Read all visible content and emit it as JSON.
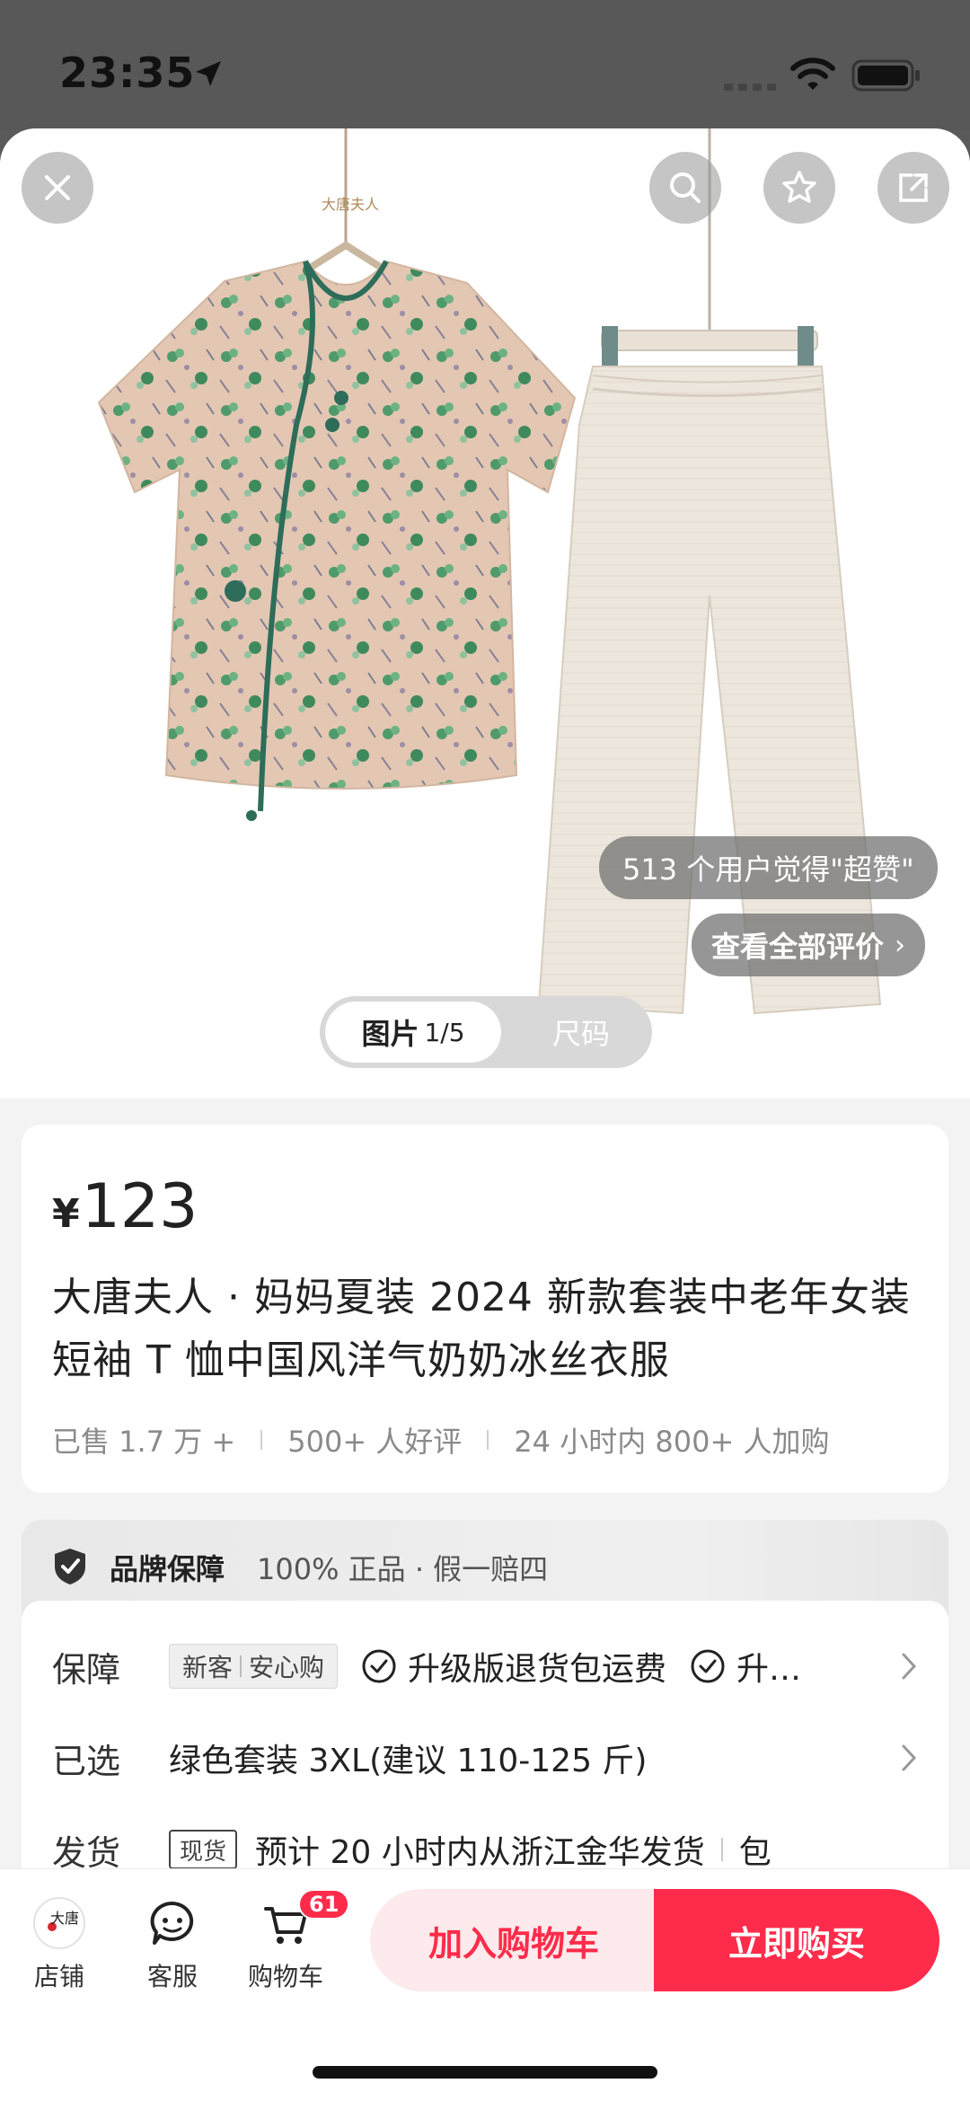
{
  "status_bar": {
    "time": "23:35"
  },
  "hero": {
    "rating_text": "513 个用户觉得\"超赞\"",
    "review_link": "查看全部评价",
    "tab_images": "图片",
    "tab_index": "1/5",
    "tab_size": "尺码",
    "brand_tag_text": "大唐夫人"
  },
  "product": {
    "currency": "¥",
    "price": "123",
    "title": "大唐夫人 · 妈妈夏装 2024 新款套装中老年女装短袖 T 恤中国风洋气奶奶冰丝衣服",
    "sold": "已售 1.7 万 +",
    "good_reviews": "500+ 人好评",
    "added_to_cart": "24 小时内 800+ 人加购"
  },
  "brand": {
    "title": "品牌保障",
    "desc": "100% 正品 · 假一赔四"
  },
  "details": {
    "guarantee_label": "保障",
    "tag_new": "新客",
    "tag_safe": "安心购",
    "check1": "升级版退货包运费",
    "check2": "升…",
    "selected_label": "已选",
    "selected_value": "绿色套装 3XL(建议 110-125 斤)",
    "ship_label": "发货",
    "ship_tag": "现货",
    "ship_value": "预计 20 小时内从浙江金华发货",
    "ship_extra": "包"
  },
  "bottom_bar": {
    "store_label": "店铺",
    "store_logo": "大唐",
    "service_label": "客服",
    "cart_label": "购物车",
    "cart_count": "61",
    "add_cart": "加入购物车",
    "buy_now": "立即购买"
  },
  "colors": {
    "accent": "#ff2b4a",
    "accent_light": "#fdeaec"
  }
}
